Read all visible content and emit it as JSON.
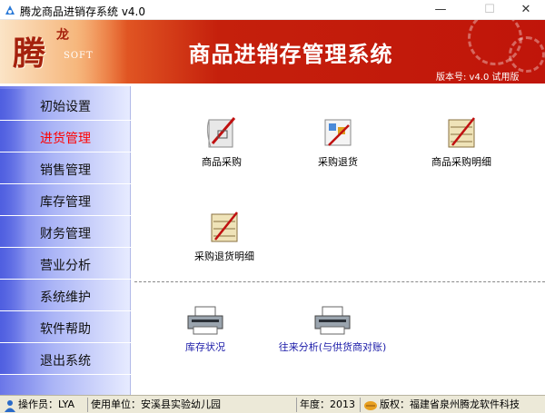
{
  "window": {
    "title": "腾龙商品进销存系统 v4.0"
  },
  "banner": {
    "logo_main": "腾",
    "logo_sub": "龙",
    "logo_soft": "SOFT",
    "title": "商品进销存管理系统",
    "version": "版本号: v4.0 试用版"
  },
  "sidebar": {
    "items": [
      {
        "label": "初始设置"
      },
      {
        "label": "进货管理"
      },
      {
        "label": "销售管理"
      },
      {
        "label": "库存管理"
      },
      {
        "label": "财务管理"
      },
      {
        "label": "营业分析"
      },
      {
        "label": "系统维护"
      },
      {
        "label": "软件帮助"
      },
      {
        "label": "退出系统"
      }
    ],
    "active_index": 1
  },
  "functions": {
    "purchase": "商品采购",
    "purchase_return": "采购退货",
    "purchase_detail": "商品采购明细",
    "return_detail": "采购退货明细",
    "stock_status": "库存状况",
    "supplier_analysis": "往来分析(与供货商对账)"
  },
  "statusbar": {
    "operator": "操作员：LYA",
    "unit": "使用单位：安溪县实验幼儿园",
    "year": "年度：2013",
    "copyright": "版权：福建省泉州腾龙软件科技"
  },
  "colors": {
    "banner_red": "#c0150a",
    "active_nav": "#ff0000",
    "link_blue": "#1a1aa8"
  }
}
